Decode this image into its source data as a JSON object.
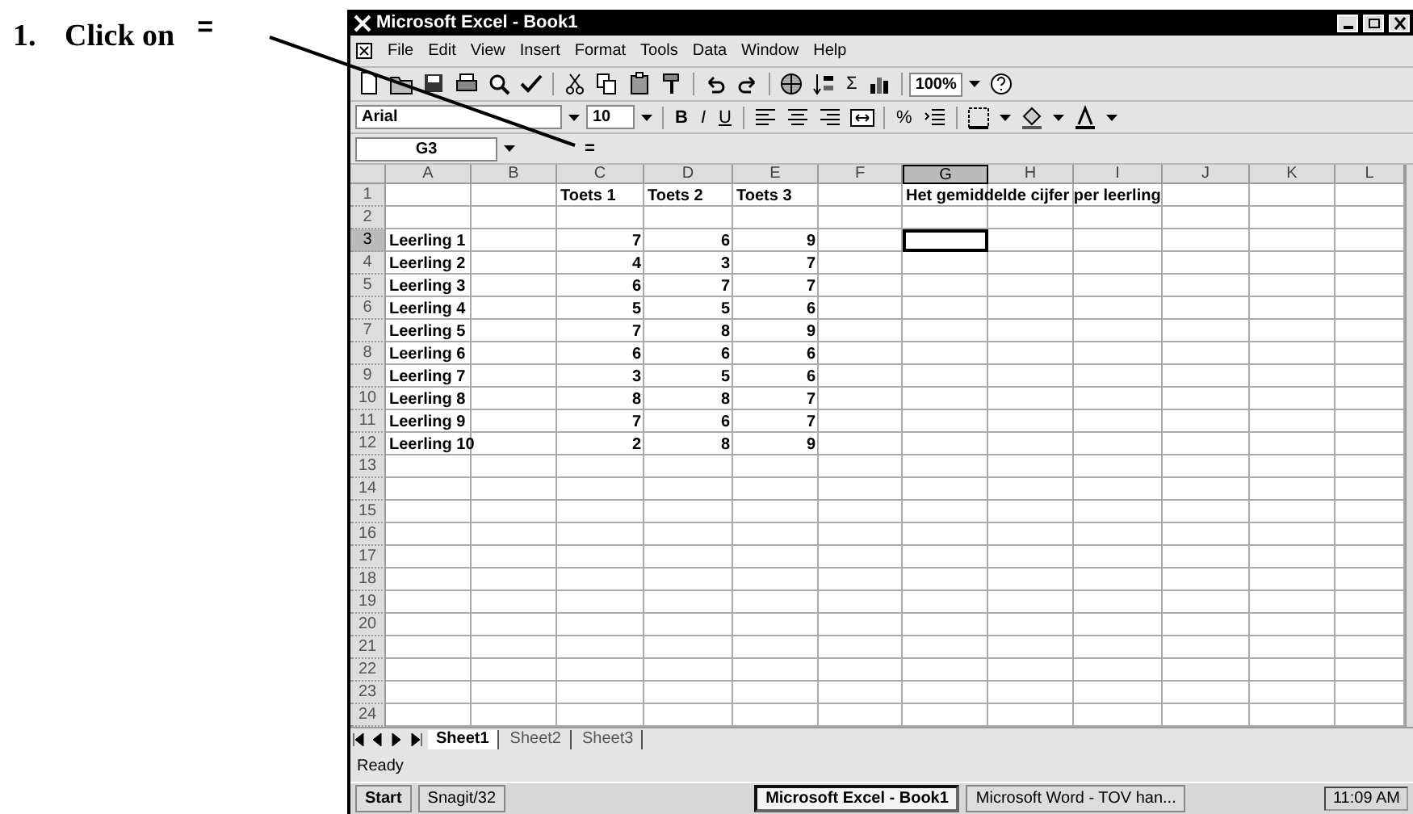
{
  "instruction": {
    "number": "1.",
    "text": "Click on",
    "symbol": "="
  },
  "window": {
    "title": "Microsoft Excel - Book1"
  },
  "menu": [
    "File",
    "Edit",
    "View",
    "Insert",
    "Format",
    "Tools",
    "Data",
    "Window",
    "Help"
  ],
  "standard_toolbar": {
    "sum": "Σ",
    "zoom": "100%"
  },
  "formatting_toolbar": {
    "font": "Arial",
    "size": "10",
    "bold": "B",
    "italic": "I",
    "underline": "U",
    "percent": "%"
  },
  "formula_bar": {
    "name_box": "G3",
    "edit_formula": "="
  },
  "columns": [
    {
      "label": "A",
      "selected": false
    },
    {
      "label": "B",
      "selected": false
    },
    {
      "label": "C",
      "selected": false
    },
    {
      "label": "D",
      "selected": false
    },
    {
      "label": "E",
      "selected": false
    },
    {
      "label": "F",
      "selected": false
    },
    {
      "label": "G",
      "selected": true
    },
    {
      "label": "H",
      "selected": false
    },
    {
      "label": "I",
      "selected": false
    },
    {
      "label": "J",
      "selected": false
    },
    {
      "label": "K",
      "selected": false
    },
    {
      "label": "L",
      "selected": false
    }
  ],
  "header_row": {
    "label": "1",
    "tests": [
      "Toets 1",
      "Toets 2",
      "Toets 3"
    ],
    "note": "Het gemiddelde cijfer per leerling"
  },
  "blank_rows_before": [
    "2"
  ],
  "rows": [
    {
      "label": "3",
      "student": "Leerling 1",
      "scores": [
        "7",
        "6",
        "9"
      ],
      "selected": true
    },
    {
      "label": "4",
      "student": "Leerling 2",
      "scores": [
        "4",
        "3",
        "7"
      ],
      "selected": false
    },
    {
      "label": "5",
      "student": "Leerling 3",
      "scores": [
        "6",
        "7",
        "7"
      ],
      "selected": false
    },
    {
      "label": "6",
      "student": "Leerling 4",
      "scores": [
        "5",
        "5",
        "6"
      ],
      "selected": false
    },
    {
      "label": "7",
      "student": "Leerling 5",
      "scores": [
        "7",
        "8",
        "9"
      ],
      "selected": false
    },
    {
      "label": "8",
      "student": "Leerling 6",
      "scores": [
        "6",
        "6",
        "6"
      ],
      "selected": false
    },
    {
      "label": "9",
      "student": "Leerling 7",
      "scores": [
        "3",
        "5",
        "6"
      ],
      "selected": false
    },
    {
      "label": "10",
      "student": "Leerling 8",
      "scores": [
        "8",
        "8",
        "7"
      ],
      "selected": false
    },
    {
      "label": "11",
      "student": "Leerling 9",
      "scores": [
        "7",
        "6",
        "7"
      ],
      "selected": false
    },
    {
      "label": "12",
      "student": "Leerling 10",
      "scores": [
        "2",
        "8",
        "9"
      ],
      "selected": false
    }
  ],
  "blank_rows_after": [
    "13",
    "14",
    "15",
    "16",
    "17",
    "18",
    "19",
    "20",
    "21",
    "22",
    "23",
    "24"
  ],
  "sheet_tabs": [
    {
      "label": "Sheet1",
      "selected": true
    },
    {
      "label": "Sheet2",
      "selected": false
    },
    {
      "label": "Sheet3",
      "selected": false
    }
  ],
  "status_bar": {
    "text": "Ready"
  },
  "taskbar": {
    "start": "Start",
    "tasks": [
      {
        "label": "Snagit/32",
        "selected": false
      },
      {
        "label": "Microsoft Excel - Book1",
        "selected": true
      },
      {
        "label": "Microsoft Word - TOV han...",
        "selected": false
      }
    ],
    "clock": "11:09 AM"
  }
}
